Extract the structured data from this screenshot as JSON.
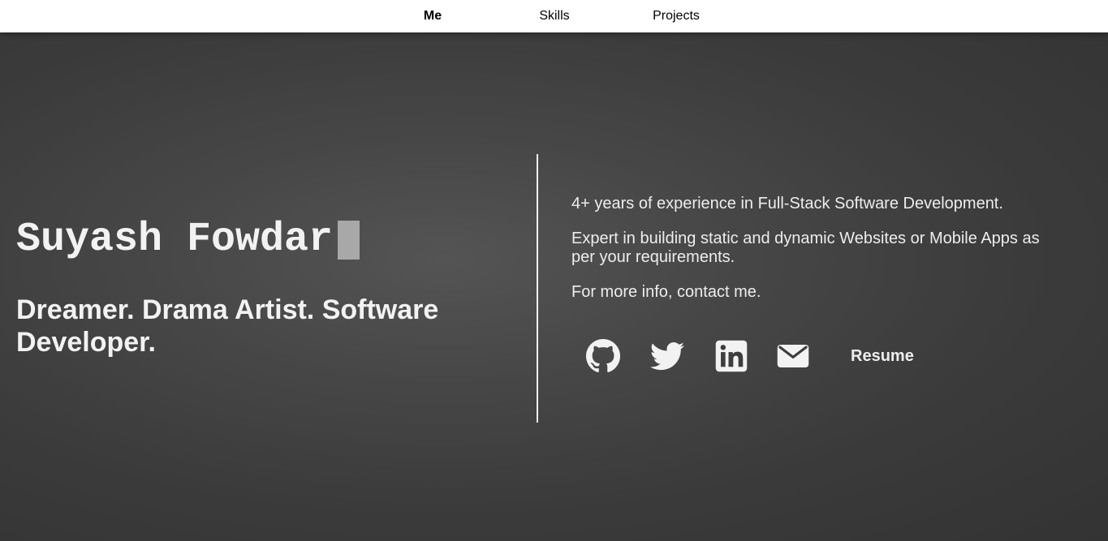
{
  "nav": {
    "items": [
      {
        "label": "Me",
        "active": true
      },
      {
        "label": "Skills",
        "active": false
      },
      {
        "label": "Projects",
        "active": false
      }
    ]
  },
  "hero": {
    "name": "Suyash Fowdar",
    "tagline": "Dreamer. Drama Artist. Software Developer."
  },
  "about": {
    "paragraphs": [
      "4+ years of experience in Full-Stack Software Development.",
      "Expert in building static and dynamic Websites or Mobile Apps as per your requirements.",
      "For more info, contact me."
    ]
  },
  "social": {
    "icons": [
      "github-icon",
      "twitter-icon",
      "linkedin-icon",
      "email-icon"
    ],
    "resume_label": "Resume"
  },
  "colors": {
    "background": "#3a3a3a",
    "text": "#f2f2f2",
    "navbar": "#ffffff",
    "cursor": "#a8a8a8"
  }
}
